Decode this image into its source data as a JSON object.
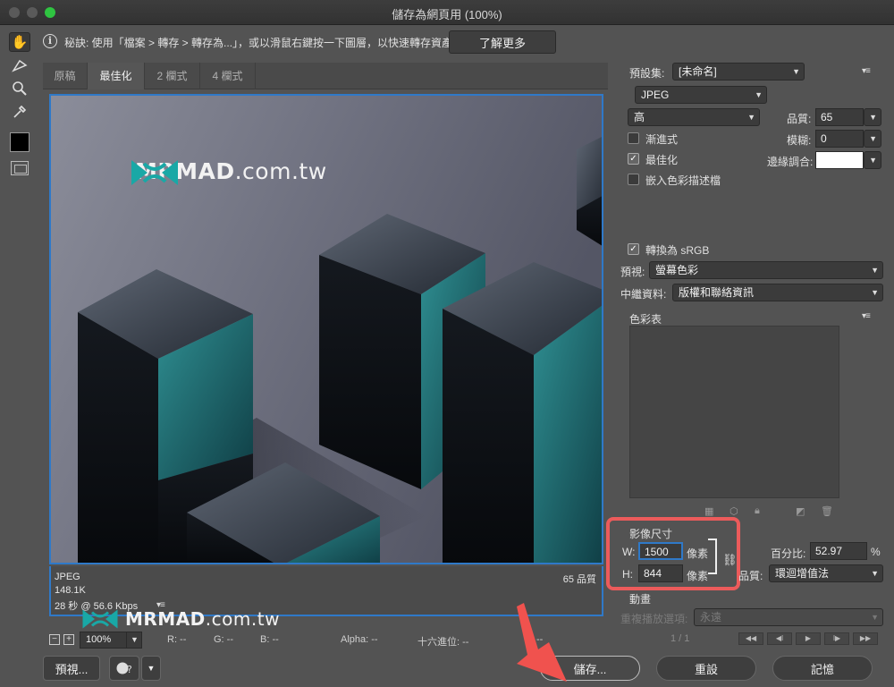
{
  "window": {
    "title": "儲存為網頁用 (100%)"
  },
  "tip": {
    "text": "秘訣: 使用「檔案 > 轉存 > 轉存為...」，或以滑鼠右鍵按一下圖層，以快速轉存資產",
    "learn_more": "了解更多"
  },
  "tabs": [
    {
      "label": "原稿"
    },
    {
      "label": "最佳化"
    },
    {
      "label": "2 欄式"
    },
    {
      "label": "4 欄式"
    }
  ],
  "watermark": {
    "brand": "MRMAD",
    "suffix": ".com.tw"
  },
  "image_info": {
    "format": "JPEG",
    "size": "148.1K",
    "speed": "28 秒 @ 56.6 Kbps",
    "quality": "65 品質"
  },
  "status": {
    "zoom": "100%",
    "r": "R: --",
    "g": "G: --",
    "b": "B: --",
    "alpha": "Alpha: --",
    "hex": "十六進位: --",
    "index": "--"
  },
  "buttons": {
    "preview": "預視...",
    "save": "儲存...",
    "reset": "重設",
    "remember": "記憶"
  },
  "settings": {
    "preset_label": "預設集:",
    "preset_value": "[未命名]",
    "format": "JPEG",
    "compression": "高",
    "quality_label": "品質:",
    "quality_value": "65",
    "progressive": "漸進式",
    "blur_label": "模糊:",
    "blur_value": "0",
    "optimized": "最佳化",
    "matte_label": "邊緣調合:",
    "embed_profile": "嵌入色彩描述檔",
    "convert_srgb": "轉換為 sRGB",
    "preview_label": "預視:",
    "preview_value": "螢幕色彩",
    "metadata_label": "中繼資料:",
    "metadata_value": "版權和聯絡資訊",
    "color_table": "色彩表"
  },
  "image_size": {
    "title": "影像尺寸",
    "w_label": "W:",
    "w_value": "1500",
    "h_label": "H:",
    "h_value": "844",
    "unit": "像素",
    "percent_label": "百分比:",
    "percent_value": "52.97",
    "percent_unit": "%",
    "quality_label": "品質:",
    "quality_value": "環迴增值法"
  },
  "animation": {
    "title": "動畫",
    "loop_label": "重複播放選項:",
    "loop_value": "永遠",
    "frame": "1 / 1"
  },
  "colors": {
    "accent": "#2f79c8",
    "highlight": "#ec5b5b",
    "logo_teal": "#19a8a6"
  }
}
